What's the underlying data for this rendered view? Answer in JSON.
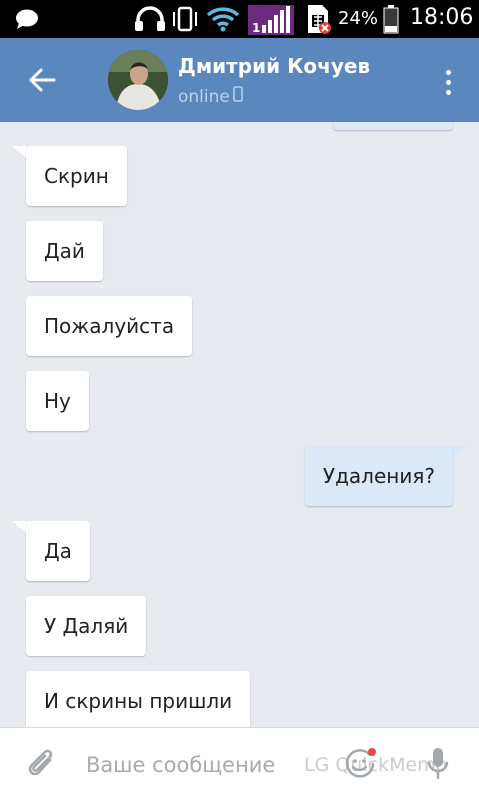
{
  "status_bar": {
    "battery_percent_text": "24%",
    "clock": "18:06",
    "sim_number": "1",
    "icons": [
      "chat-bubble-icon",
      "headphones-icon",
      "phone-vibrate-icon",
      "wifi-icon",
      "signal-icon",
      "sim-error-icon",
      "battery-icon"
    ],
    "battery_level": 0.24
  },
  "header": {
    "back_icon": "arrow-left-icon",
    "contact_name": "Дмитрий Кочуев",
    "presence": "online",
    "presence_icon": "mobile-phone-icon",
    "menu_icon": "more-vertical-icon",
    "background_color": "#5a87be"
  },
  "messages": [
    {
      "direction": "out",
      "text": ""
    },
    {
      "direction": "in",
      "text": "Скрин"
    },
    {
      "direction": "in",
      "text": "Дай"
    },
    {
      "direction": "in",
      "text": "Пожалуйста"
    },
    {
      "direction": "in",
      "text": "Ну"
    },
    {
      "direction": "out",
      "text": "Удаления?"
    },
    {
      "direction": "in",
      "text": "Да"
    },
    {
      "direction": "in",
      "text": "У Даляй"
    },
    {
      "direction": "in",
      "text": "И скрины пришли"
    }
  ],
  "input_bar": {
    "attach_icon": "paperclip-icon",
    "placeholder": "Ваше сообщение",
    "watermark": "LG QuickMemo",
    "sticker_icon": "smiley-icon",
    "mic_icon": "microphone-icon"
  },
  "colors": {
    "incoming_bubble": "#ffffff",
    "outgoing_bubble": "#dbe8f7",
    "chat_background": "#e7ebf0"
  }
}
